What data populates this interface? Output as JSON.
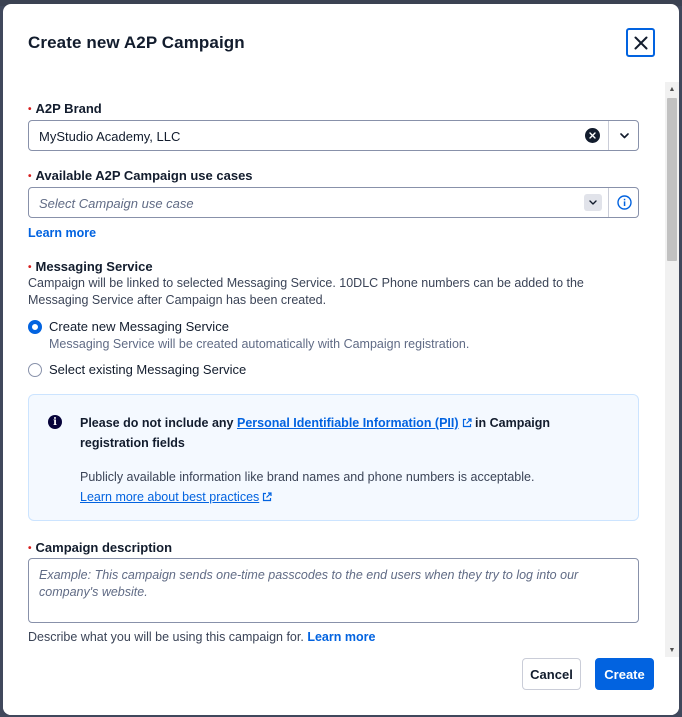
{
  "modal": {
    "title": "Create new A2P Campaign"
  },
  "brand": {
    "label": "A2P Brand",
    "value": "MyStudio Academy, LLC"
  },
  "use_case": {
    "label": "Available A2P Campaign use cases",
    "placeholder": "Select Campaign use case",
    "learn_more": "Learn more"
  },
  "messaging_service": {
    "label": "Messaging Service",
    "help": "Campaign will be linked to selected Messaging Service. 10DLC Phone numbers can be added to the Messaging Service after Campaign has been created.",
    "options": [
      {
        "label": "Create new Messaging Service",
        "sub": "Messaging Service will be created automatically with Campaign registration.",
        "checked": true
      },
      {
        "label": "Select existing Messaging Service",
        "checked": false
      }
    ]
  },
  "callout": {
    "title_before": "Please do not include any ",
    "title_link": "Personal Identifiable Information (PII)",
    "title_after": " in Campaign registration fields",
    "body": "Publicly available information like brand names and phone numbers is acceptable.",
    "body_link": "Learn more about best practices"
  },
  "description": {
    "label": "Campaign description",
    "placeholder": "Example: This campaign sends one-time passcodes to the end users when they try to log into our company's website.",
    "help": "Describe what you will be using this campaign for.",
    "help_link": "Learn more"
  },
  "footer": {
    "cancel": "Cancel",
    "create": "Create"
  },
  "colors": {
    "primary": "#0263e0",
    "required": "#d61f1f",
    "callout_bg": "#f4f9ff"
  }
}
